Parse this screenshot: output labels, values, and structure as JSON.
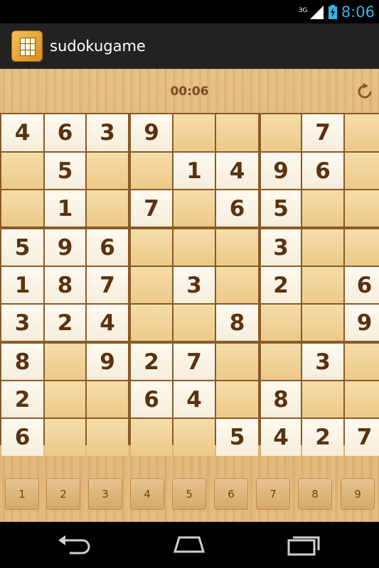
{
  "status_bar": {
    "network": "3G",
    "time": "8:06"
  },
  "app": {
    "title": "sudokugame"
  },
  "timer": "00:06",
  "board": [
    [
      "4",
      "6",
      "3",
      "9",
      "",
      "",
      "",
      "7",
      ""
    ],
    [
      "",
      "5",
      "",
      "",
      "1",
      "4",
      "9",
      "6",
      ""
    ],
    [
      "",
      "1",
      "",
      "7",
      "",
      "6",
      "5",
      "",
      ""
    ],
    [
      "5",
      "9",
      "6",
      "",
      "",
      "",
      "3",
      "",
      ""
    ],
    [
      "1",
      "8",
      "7",
      "",
      "3",
      "",
      "2",
      "",
      "6"
    ],
    [
      "3",
      "2",
      "4",
      "",
      "",
      "8",
      "",
      "",
      "9"
    ],
    [
      "8",
      "",
      "9",
      "2",
      "7",
      "",
      "",
      "3",
      ""
    ],
    [
      "2",
      "",
      "",
      "6",
      "4",
      "",
      "8",
      "",
      ""
    ],
    [
      "6",
      "",
      "",
      "",
      "",
      "5",
      "4",
      "2",
      "7"
    ]
  ],
  "number_pad": [
    "1",
    "2",
    "3",
    "4",
    "5",
    "6",
    "7",
    "8",
    "9"
  ],
  "icons": {
    "refresh": "refresh-icon",
    "back": "back-icon",
    "home": "home-icon",
    "recents": "recents-icon"
  },
  "colors": {
    "clock": "#33b5e5",
    "digit": "#5a3210",
    "timer": "#7a4d1c"
  }
}
